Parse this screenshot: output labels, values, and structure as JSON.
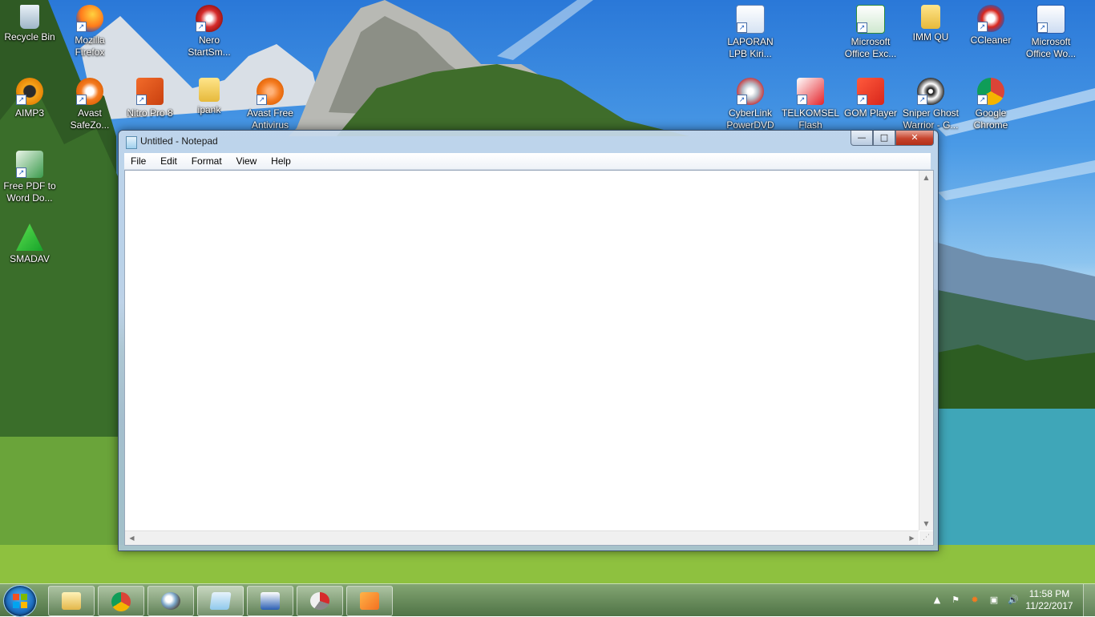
{
  "desktop": {
    "icons": [
      {
        "label": "Recycle Bin"
      },
      {
        "label": "Mozilla Firefox"
      },
      {
        "label": "Nero StartSm..."
      },
      {
        "label": "AIMP3"
      },
      {
        "label": "Avast SafeZo..."
      },
      {
        "label": "Nitro Pro 8"
      },
      {
        "label": "ipank"
      },
      {
        "label": "Avast Free Antivirus"
      },
      {
        "label": "Free PDF to Word Do..."
      },
      {
        "label": "SMADAV"
      },
      {
        "label": "LAPORAN LPB Kiri..."
      },
      {
        "label": "Microsoft Office Exc..."
      },
      {
        "label": "IMM QU"
      },
      {
        "label": "CCleaner"
      },
      {
        "label": "Microsoft Office Wo..."
      },
      {
        "label": "CyberLink PowerDVD"
      },
      {
        "label": "TELKOMSEL Flash"
      },
      {
        "label": "GOM Player"
      },
      {
        "label": "Sniper Ghost Warrior - G..."
      },
      {
        "label": "Google Chrome"
      }
    ]
  },
  "window": {
    "title": "Untitled - Notepad",
    "controls": {
      "minimize": "—",
      "maximize": "□",
      "close": "✕"
    },
    "menu": [
      "File",
      "Edit",
      "Format",
      "View",
      "Help"
    ],
    "content": ""
  },
  "taskbar": {
    "clock_time": "11:58 PM",
    "clock_date": "11/22/2017"
  },
  "colors": {
    "close_button": "#c6432c",
    "taskbar": "#4e7a3e",
    "start_orb": "#1e6fc2"
  }
}
